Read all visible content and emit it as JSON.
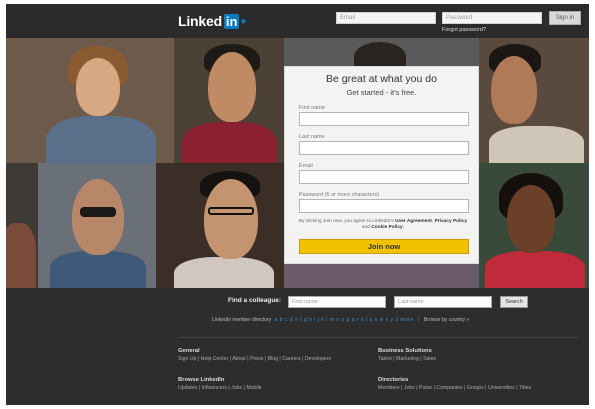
{
  "header": {
    "logo_word": "Linked",
    "logo_in": "in",
    "email_placeholder": "Email",
    "password_placeholder": "Password",
    "signin_label": "Sign in",
    "forgot_label": "Forgot password?"
  },
  "signup": {
    "title": "Be great at what you do",
    "subtitle": "Get started - it's free.",
    "first_name_label": "First name",
    "last_name_label": "Last name",
    "email_label": "Email",
    "password_label": "Password (6 or more characters)",
    "agreement_prefix": "By clicking Join now, you agree to LinkedIn's",
    "user_agreement": "User Agreement",
    "privacy_policy": "Privacy Policy",
    "and_text": "and",
    "cookie_policy": "Cookie Policy",
    "join_label": "Join now"
  },
  "find": {
    "label": "Find a colleague:",
    "first_placeholder": "First name",
    "last_placeholder": "Last name",
    "search_label": "Search"
  },
  "directory": {
    "label": "LinkedIn member directory",
    "letters": "a b c d e f g h i j k l m n o p q r s t u v w x y z more",
    "browse_country": "Browse by country »"
  },
  "footer": {
    "general": {
      "heading": "General",
      "links": "Sign Up | Help Center | About | Press | Blog | Careers | Developers"
    },
    "business": {
      "heading": "Business Solutions",
      "links": "Talent | Marketing | Sales"
    },
    "browse": {
      "heading": "Browse LinkedIn",
      "links": "Updates | Influencers | Jobs | Mobile"
    },
    "directories": {
      "heading": "Directories",
      "links": "Members | Jobs | Pulse | Companies | Groups | Universities | Titles"
    }
  },
  "colors": {
    "brand_blue": "#0a7bbf",
    "join_yellow": "#f0c200",
    "page_dark": "#2d2d2d"
  }
}
